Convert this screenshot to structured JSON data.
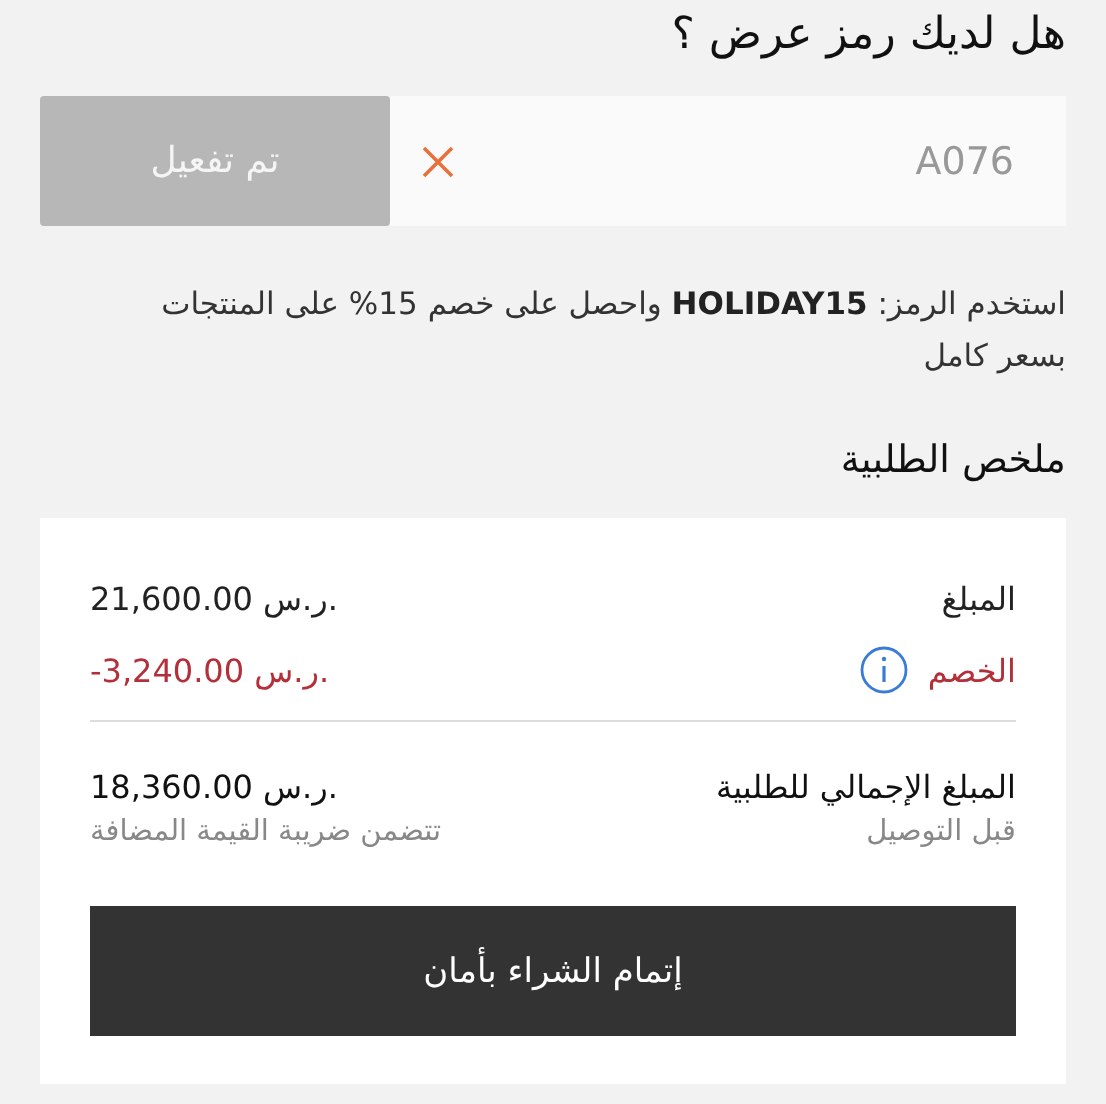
{
  "promo": {
    "heading": "هل لديك رمز عرض ؟",
    "code_value": "A076",
    "apply_button": {
      "label": "تم تفعيل",
      "disabled": true
    },
    "note": "استخدم الرمز: **HOLIDAY15** واحصل على خصم 15% على المنتجات بسعر كامل"
  },
  "summary": {
    "title": "ملخص الطلبية",
    "lines": [
      {
        "label": "المبلغ",
        "amount": "21,600.00 ر.س.",
        "kind": "normal"
      },
      {
        "label": "الخصم",
        "amount": "-3,240.00 ر.س.",
        "kind": "discount"
      }
    ],
    "total": {
      "label": "المبلغ الإجمالي للطلبية",
      "amount": "18,360.00 ر.س.",
      "note": "قبل التوصيل",
      "tax_note": "تتضمن ضريبة القيمة المضافة"
    },
    "checkout_button": "إتمام الشراء بأمان"
  }
}
